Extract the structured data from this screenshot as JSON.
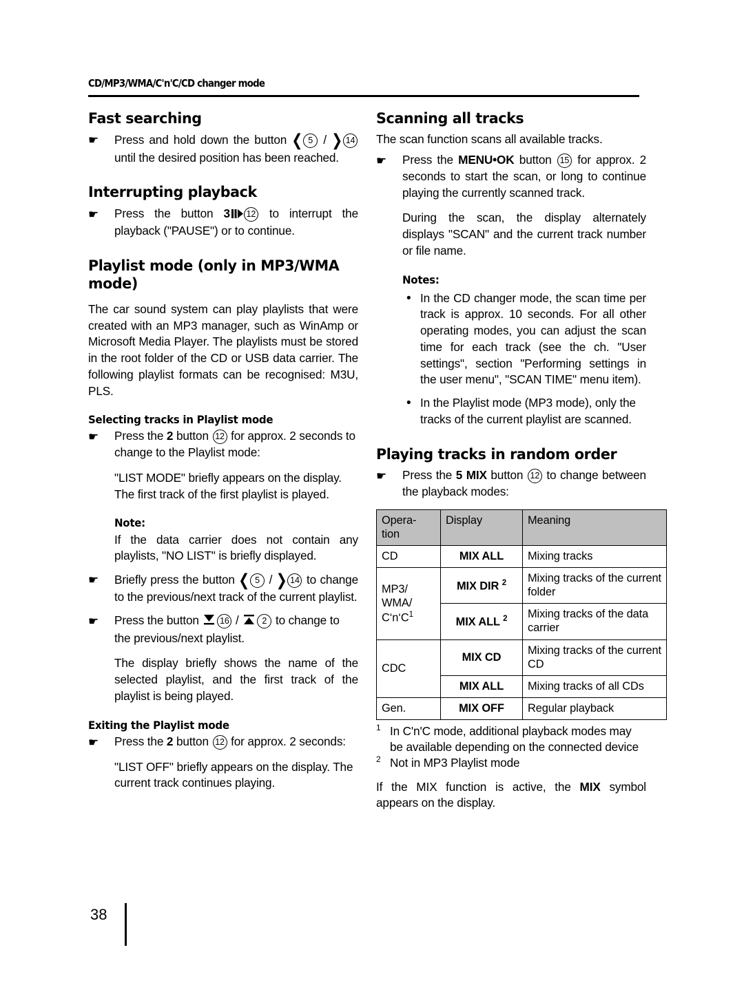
{
  "header": {
    "running_title": "CD/MP3/WMA/C'n'C/CD changer mode"
  },
  "footer": {
    "page_number": "38"
  },
  "left_column": {
    "fast_searching": {
      "heading": "Fast searching",
      "item_pre": "Press and hold down the button",
      "item_post": "until the desired position has been reached.",
      "btn_prev_num": "5",
      "btn_next_num": "14"
    },
    "interrupting_playback": {
      "heading": "Interrupting playback",
      "text_pre": "Press the button",
      "btn_label": "3",
      "btn_num": "12",
      "text_post": "to interrupt the playback (\"PAUSE\") or to continue."
    },
    "playlist_mode": {
      "heading": "Playlist mode (only in MP3/WMA mode)",
      "paragraph": "The car sound system can play playlists that were created with an MP3 manager, such as WinAmp or Microsoft Media Player. The playlists must be stored in the root folder of the CD or USB data carrier. The following playlist formats can be recognised: M3U, PLS.",
      "selecting_heading": "Selecting tracks in Playlist mode",
      "select_pre": "Press the",
      "select_btn_label": "2",
      "select_btn_word": "button",
      "select_btn_num": "12",
      "select_post": "for approx. 2 seconds to change to the Playlist mode:",
      "list_mode_text": "\"LIST MODE\" briefly appears on the display. The first track of the first playlist is played.",
      "note_heading": "Note:",
      "note_text": "If the data carrier does not contain any playlists, \"NO LIST\" is briefly displayed.",
      "briefly_pre": "Briefly press the button",
      "briefly_prev_num": "5",
      "briefly_next_num": "14",
      "briefly_post": "to change to the previous/next track of the current playlist.",
      "press_updown_pre": "Press the button",
      "down_num": "16",
      "up_num": "2",
      "press_updown_post": "to change to the previous/next playlist.",
      "display_text": "The display briefly shows the name of the selected playlist, and the first track of the playlist is being played.",
      "exiting_heading": "Exiting the Playlist mode",
      "exit_pre": "Press the",
      "exit_btn_label": "2",
      "exit_btn_word": "button",
      "exit_btn_num": "12",
      "exit_post": "for approx. 2 seconds:",
      "list_off_text": "\"LIST OFF\" briefly appears on the display. The current track continues playing."
    }
  },
  "right_column": {
    "scanning": {
      "heading": "Scanning all tracks",
      "intro": "The scan function scans all available tracks.",
      "press_pre": "Press the",
      "menu_ok_label": "MENU•OK",
      "button_word": "button",
      "btn_num": "15",
      "press_post": "for approx. 2 seconds to start the scan, or long to continue playing the currently scanned track.",
      "during_text": "During the scan, the display alternately displays \"SCAN\" and the current track number or file name.",
      "notes_heading": "Notes:",
      "note1": "In the CD changer mode, the scan time per track is approx. 10 seconds. For all other operating modes, you can adjust the scan time for each track (see the ch. \"User settings\", section \"Performing settings in the user menu\", \"SCAN TIME\" menu item).",
      "note2": "In the Playlist mode (MP3 mode), only the tracks of the current playlist are scanned."
    },
    "random_order": {
      "heading": "Playing tracks in random order",
      "press_pre": "Press the",
      "btn_label": "5 MIX",
      "button_word": "button",
      "btn_num": "12",
      "press_post": "to change between the playback modes:",
      "table": {
        "headers": [
          "Opera-\ntion",
          "Display",
          "Meaning"
        ],
        "rows": [
          {
            "operation": "CD",
            "op_rowspan": 1,
            "display": "MIX ALL",
            "display_sup": "",
            "meaning": "Mixing tracks"
          },
          {
            "operation": "MP3/\nWMA/\nC'n'C",
            "op_sup": "1",
            "op_rowspan": 2,
            "display": "MIX DIR",
            "display_sup": "2",
            "meaning": "Mixing tracks of the current folder"
          },
          {
            "operation": "",
            "op_rowspan": 0,
            "display": "MIX ALL",
            "display_sup": "2",
            "meaning": "Mixing tracks of the data carrier"
          },
          {
            "operation": "CDC",
            "op_rowspan": 2,
            "display": "MIX CD",
            "display_sup": "",
            "meaning": "Mixing tracks of the current CD"
          },
          {
            "operation": "",
            "op_rowspan": 0,
            "display": "MIX ALL",
            "display_sup": "",
            "meaning": "Mixing tracks of all CDs"
          },
          {
            "operation": "Gen.",
            "op_rowspan": 1,
            "display": "MIX OFF",
            "display_sup": "",
            "meaning": "Regular playback"
          }
        ]
      },
      "footnote1_mark": "1",
      "footnote1": "In C'n'C mode, additional playback modes may be available depending on the connected device",
      "footnote2_mark": "2",
      "footnote2": "Not in MP3 Playlist mode",
      "closing_pre": "If the MIX function is active, the",
      "closing_bold": "MIX",
      "closing_post": "symbol appears on the display."
    }
  },
  "icons": {
    "hand_bullet": "☛",
    "dot_bullet": "•",
    "prev_chevron": "❮",
    "next_chevron": "❯"
  },
  "colors": {
    "text": "#000000",
    "table_header_bg": "#bfbfbf",
    "page_bg": "#ffffff"
  }
}
